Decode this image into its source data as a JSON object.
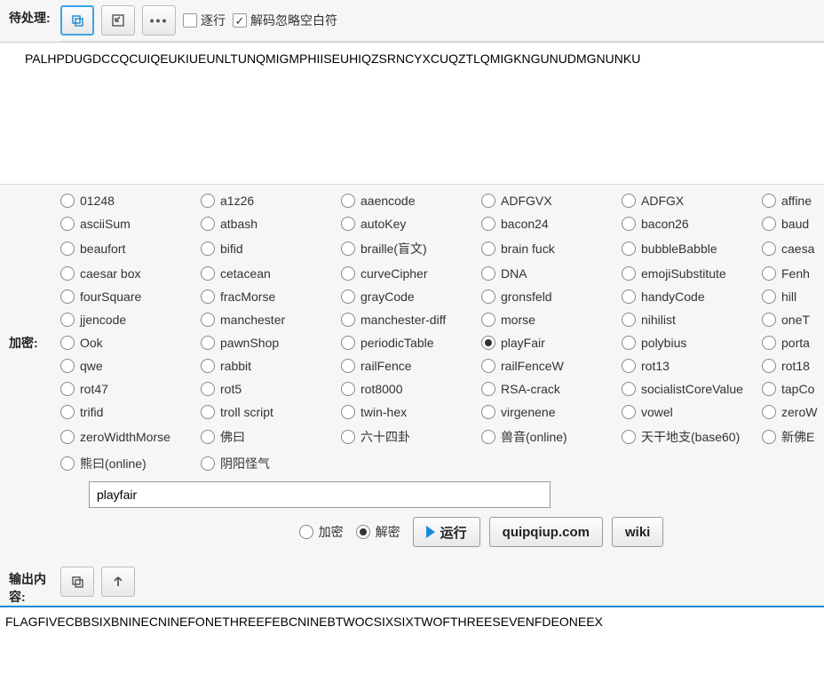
{
  "labels": {
    "pending": "待处理:",
    "encrypt_section": "加密:",
    "output_section": "输出内容:"
  },
  "toolbar": {
    "line_by_line": "逐行",
    "ignore_space": "解码忽略空白符"
  },
  "input_text": "PALHPDUGDCCQCUIQEUKIUEUNLTUNQMIGMPHIISEUHIQZSRNCYXCUQZTLQMIGKNGUNUDMGNUNKU",
  "ciphers": [
    "01248",
    "a1z26",
    "aaencode",
    "ADFGVX",
    "ADFGX",
    "affine",
    "asciiSum",
    "atbash",
    "autoKey",
    "bacon24",
    "bacon26",
    "baud",
    "beaufort",
    "bifid",
    "braille(盲文)",
    "brain fuck",
    "bubbleBabble",
    "caesa",
    "caesar box",
    "cetacean",
    "curveCipher",
    "DNA",
    "emojiSubstitute",
    "Fenh",
    "fourSquare",
    "fracMorse",
    "grayCode",
    "gronsfeld",
    "handyCode",
    "hill",
    "jjencode",
    "manchester",
    "manchester-diff",
    "morse",
    "nihilist",
    "oneT",
    "Ook",
    "pawnShop",
    "periodicTable",
    "playFair",
    "polybius",
    "porta",
    "qwe",
    "rabbit",
    "railFence",
    "railFenceW",
    "rot13",
    "rot18",
    "rot47",
    "rot5",
    "rot8000",
    "RSA-crack",
    "socialistCoreValue",
    "tapCo",
    "trifid",
    "troll script",
    "twin-hex",
    "virgenene",
    "vowel",
    "zeroW",
    "zeroWidthMorse",
    "佛曰",
    "六十四卦",
    "兽音(online)",
    "天干地支(base60)",
    "新佛E",
    "熊曰(online)",
    "阴阳怪气"
  ],
  "selected_cipher": "playFair",
  "key_value": "playfair",
  "mode": {
    "encrypt_label": "加密",
    "decrypt_label": "解密",
    "selected": "解密"
  },
  "buttons": {
    "run": "运行",
    "quipqiup": "quipqiup.com",
    "wiki": "wiki"
  },
  "output_text": "FLAGFIVECBBSIXBNINECNINEFONETHREEFEBCNINEBTWOCSIXSIXTWOFTHREESEVENFDEONEEX"
}
